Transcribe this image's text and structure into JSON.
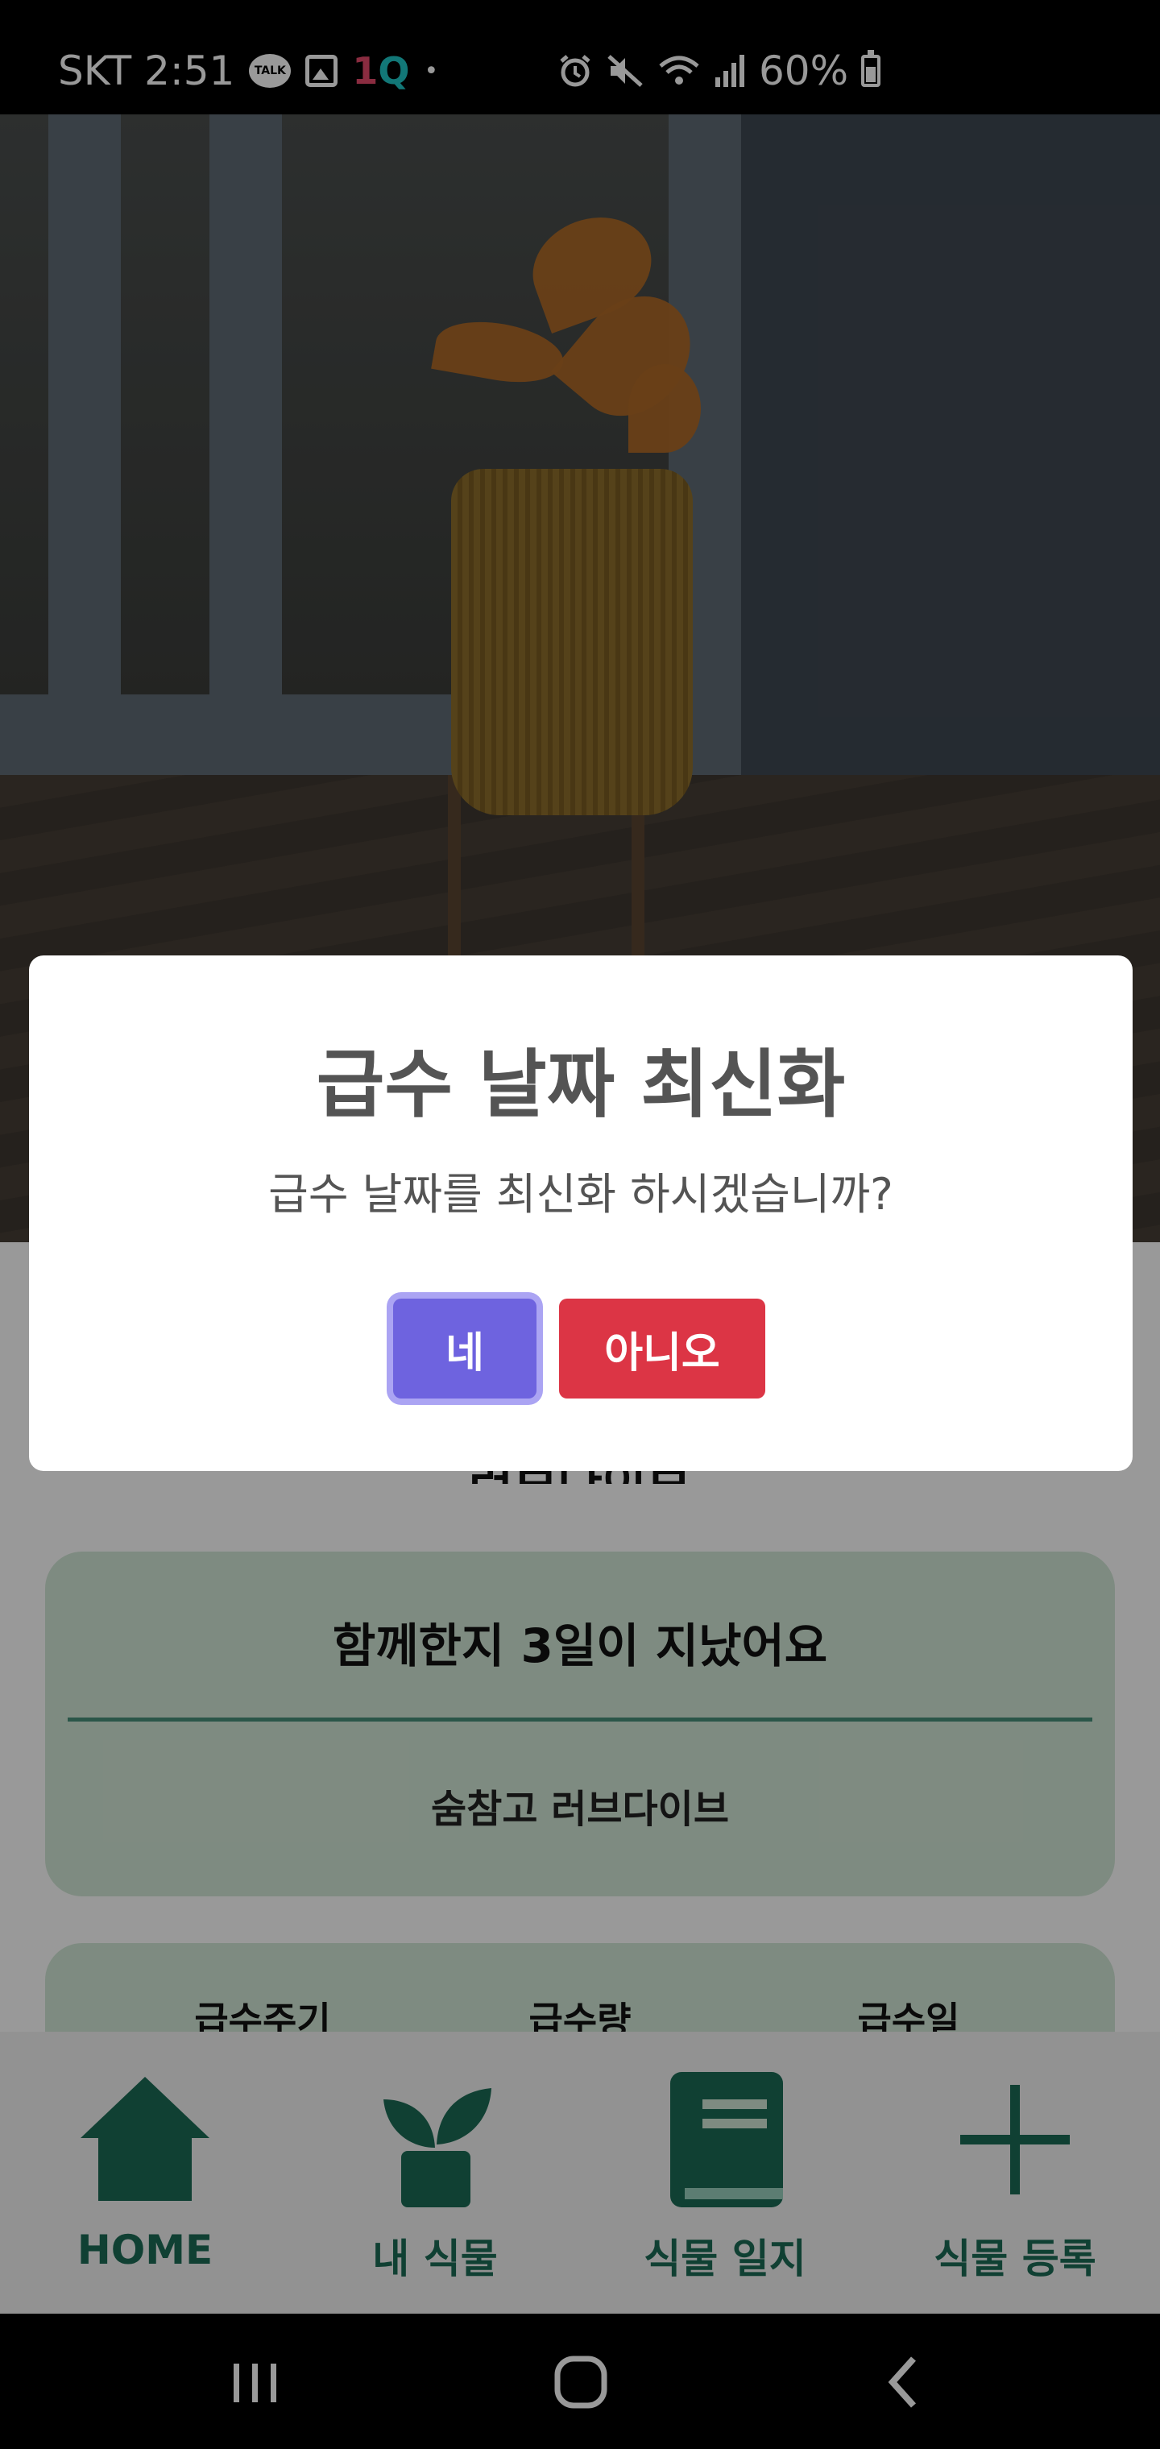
{
  "status_bar": {
    "carrier_time": "SKT 2:51",
    "talk_icon_text": "TALK",
    "app_badge_one": "1",
    "app_badge_q": "Q",
    "dot": "•",
    "battery_percent": "60%"
  },
  "plant_name_partial": "러브다이브",
  "info_card": {
    "title": "함께한지 3일이 지났어요",
    "subtitle": "숨참고 러브다이브"
  },
  "watering_headers": [
    "급수주기",
    "급수량",
    "급수일"
  ],
  "bottom_nav": [
    {
      "label": "HOME",
      "icon": "home-icon"
    },
    {
      "label": "내 식물",
      "icon": "plant-icon"
    },
    {
      "label": "식물 일지",
      "icon": "book-icon"
    },
    {
      "label": "식물 등록",
      "icon": "plus-icon"
    }
  ],
  "dialog": {
    "title": "급수 날짜 최신화",
    "message": "급수 날짜를 최신화 하시겠습니까?",
    "confirm_label": "네",
    "cancel_label": "아니오"
  },
  "colors": {
    "confirm": "#6e63df",
    "cancel": "#dc3545",
    "accent_green": "#1c6c55",
    "card_bg": "#d3e8d7"
  }
}
